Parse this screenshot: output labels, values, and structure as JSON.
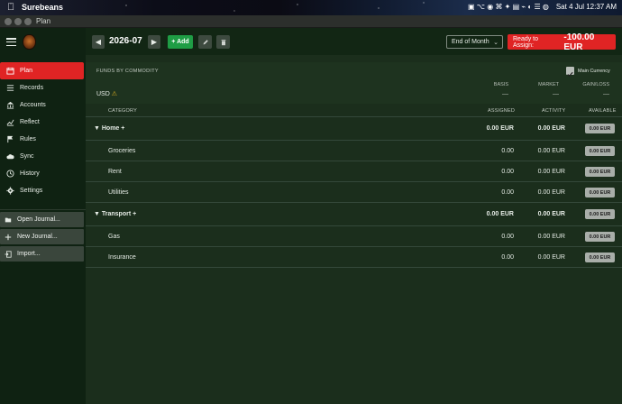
{
  "menubar": {
    "app_name": "Surebeans",
    "status_clock": "Sat 4 Jul  12:37 AM"
  },
  "window": {
    "title": "Plan"
  },
  "sidebar": {
    "items": [
      {
        "label": "Plan",
        "icon": "calendar-icon",
        "active": true
      },
      {
        "label": "Records",
        "icon": "list-icon"
      },
      {
        "label": "Accounts",
        "icon": "bank-icon"
      },
      {
        "label": "Reflect",
        "icon": "chart-icon"
      },
      {
        "label": "Rules",
        "icon": "flag-icon"
      },
      {
        "label": "Sync",
        "icon": "cloud-icon"
      },
      {
        "label": "History",
        "icon": "history-icon"
      },
      {
        "label": "Settings",
        "icon": "gear-icon"
      }
    ],
    "journal": [
      {
        "label": "Open Journal...",
        "icon": "folder-icon"
      },
      {
        "label": "New Journal...",
        "icon": "plus-icon"
      },
      {
        "label": "Import...",
        "icon": "import-icon"
      }
    ]
  },
  "toolbar": {
    "month": "2026-07",
    "add_label": "+ Add",
    "period": "End of Month",
    "ready_label": "Ready to Assign:",
    "ready_amount": "-100.00 EUR"
  },
  "funds": {
    "header": "FUNDS BY COMMODITY",
    "currency": "USD",
    "main_currency_label": "Main Currency",
    "main_currency_checked": true,
    "columns": [
      "BASIS",
      "MARKET",
      "GAIN/LOSS"
    ],
    "values": [
      "—",
      "—",
      "—"
    ]
  },
  "table": {
    "headers": {
      "category": "CATEGORY",
      "assigned": "ASSIGNED",
      "activity": "ACTIVITY",
      "available": "AVAILABLE"
    },
    "groups": [
      {
        "name": "Home",
        "assigned": "0.00 EUR",
        "activity": "0.00 EUR",
        "available": "0.00 EUR",
        "rows": [
          {
            "name": "Groceries",
            "assigned": "0.00",
            "activity": "0.00 EUR",
            "available": "0.00 EUR"
          },
          {
            "name": "Rent",
            "assigned": "0.00",
            "activity": "0.00 EUR",
            "available": "0.00 EUR"
          },
          {
            "name": "Utilities",
            "assigned": "0.00",
            "activity": "0.00 EUR",
            "available": "0.00 EUR"
          }
        ]
      },
      {
        "name": "Transport",
        "assigned": "0.00 EUR",
        "activity": "0.00 EUR",
        "available": "0.00 EUR",
        "rows": [
          {
            "name": "Gas",
            "assigned": "0.00",
            "activity": "0.00 EUR",
            "available": "0.00 EUR"
          },
          {
            "name": "Insurance",
            "assigned": "0.00",
            "activity": "0.00 EUR",
            "available": "0.00 EUR"
          }
        ]
      }
    ]
  },
  "colors": {
    "accent_red": "#e02424",
    "add_green": "#1f9d45",
    "sidebar_bg": "#0f2212",
    "main_bg": "#1b2e1c"
  }
}
